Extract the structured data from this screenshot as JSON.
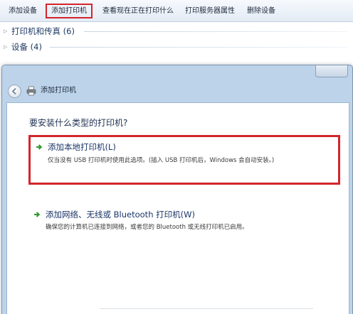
{
  "toolbar": {
    "items": [
      {
        "label": "添加设备"
      },
      {
        "label": "添加打印机"
      },
      {
        "label": "查看现在正在打印什么"
      },
      {
        "label": "打印服务器属性"
      },
      {
        "label": "删除设备"
      }
    ],
    "highlighted_index": 1,
    "highlight_color": "#d2262b"
  },
  "groups": [
    {
      "label": "打印机和传真 (6)",
      "icon": "expand-arrow-icon"
    },
    {
      "label": "设备 (4)",
      "icon": "expand-arrow-icon"
    }
  ],
  "dialog": {
    "title": "添加打印机",
    "question": "要安装什么类型的打印机?",
    "options": [
      {
        "title": "添加本地打印机(L)",
        "description": "仅当没有 USB 打印机时使用此选项。(插入 USB 打印机后，Windows 会自动安装。)",
        "icon": "green-arrow-icon",
        "highlighted": true
      },
      {
        "title": "添加网络、无线或 Bluetooth 打印机(W)",
        "description": "确保您的计算机已连接到网络，或者您的 Bluetooth 或无线打印机已启用。",
        "icon": "green-arrow-icon",
        "highlighted": false
      }
    ]
  },
  "colors": {
    "accent_highlight": "#d2262b",
    "link_title": "#1a3568",
    "arrow_green": "#2f9a2f",
    "dialog_frame": "#bcd3ea"
  }
}
